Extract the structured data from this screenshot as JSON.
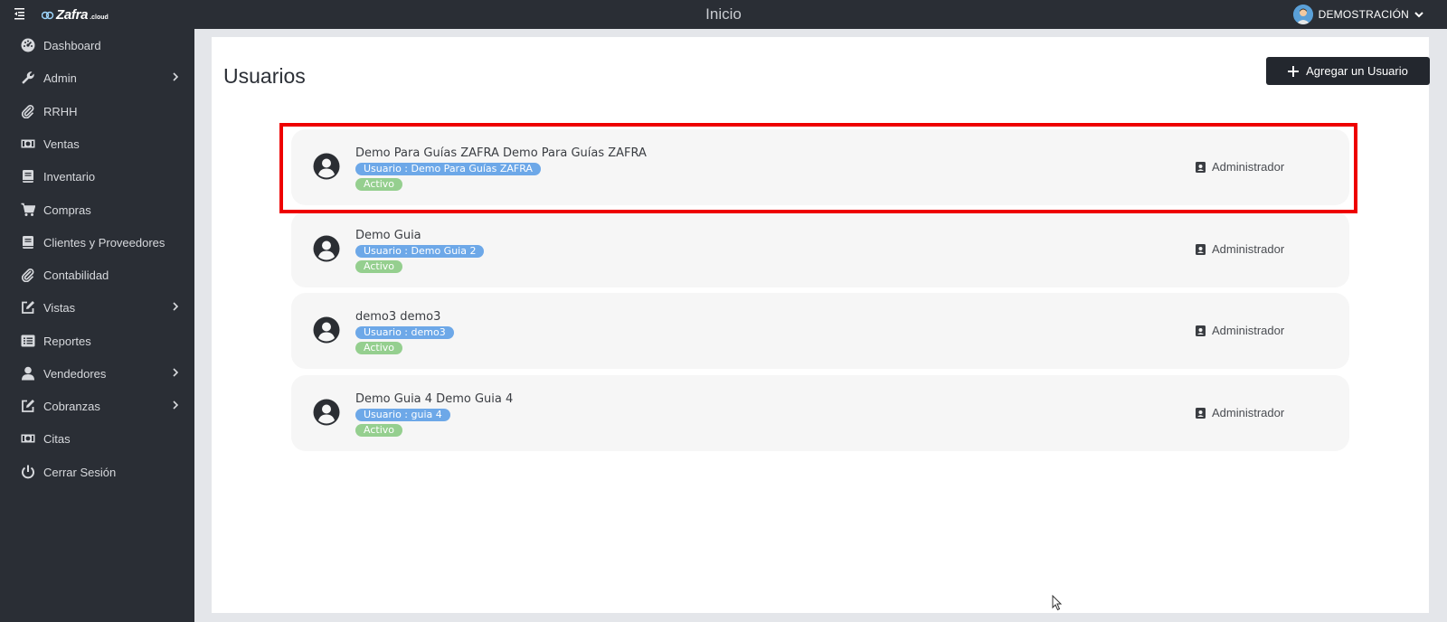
{
  "header": {
    "logo_text": "Zafra",
    "logo_sub": ".cloud",
    "title": "Inicio",
    "user_name": "DEMOSTRACIÓN"
  },
  "sidebar": {
    "items": [
      {
        "label": "Dashboard",
        "icon": "dashboard-icon",
        "has_submenu": false
      },
      {
        "label": "Admin",
        "icon": "wrench-icon",
        "has_submenu": true
      },
      {
        "label": "RRHH",
        "icon": "paperclip-icon",
        "has_submenu": false
      },
      {
        "label": "Ventas",
        "icon": "money-icon",
        "has_submenu": false
      },
      {
        "label": "Inventario",
        "icon": "book-icon",
        "has_submenu": false
      },
      {
        "label": "Compras",
        "icon": "cart-icon",
        "has_submenu": false
      },
      {
        "label": "Clientes y Proveedores",
        "icon": "book-icon",
        "has_submenu": false
      },
      {
        "label": "Contabilidad",
        "icon": "paperclip-icon",
        "has_submenu": false
      },
      {
        "label": "Vistas",
        "icon": "edit-icon",
        "has_submenu": true
      },
      {
        "label": "Reportes",
        "icon": "list-icon",
        "has_submenu": false
      },
      {
        "label": "Vendedores",
        "icon": "person-icon",
        "has_submenu": true
      },
      {
        "label": "Cobranzas",
        "icon": "edit-icon",
        "has_submenu": true
      },
      {
        "label": "Citas",
        "icon": "money-icon",
        "has_submenu": false
      },
      {
        "label": "Cerrar Sesión",
        "icon": "power-icon",
        "has_submenu": false
      }
    ]
  },
  "main": {
    "title": "Usuarios",
    "add_button_label": "Agregar un Usuario",
    "users": [
      {
        "name": "Demo Para Guías ZAFRA Demo Para Guías ZAFRA",
        "username": "Usuario : Demo Para Guías ZAFRA",
        "status": "Activo",
        "role": "Administrador"
      },
      {
        "name": "Demo Guia",
        "username": "Usuario : Demo Guia 2",
        "status": "Activo",
        "role": "Administrador"
      },
      {
        "name": "demo3 demo3",
        "username": "Usuario : demo3",
        "status": "Activo",
        "role": "Administrador"
      },
      {
        "name": "Demo Guia 4 Demo Guia 4",
        "username": "Usuario : guia 4",
        "status": "Activo",
        "role": "Administrador"
      }
    ]
  },
  "colors": {
    "sidebar_bg": "#2a2e35",
    "highlight": "#ee0000",
    "user_badge": "#6da8e8",
    "status_badge": "#95cf8f",
    "row_bg": "#f6f6f6"
  }
}
